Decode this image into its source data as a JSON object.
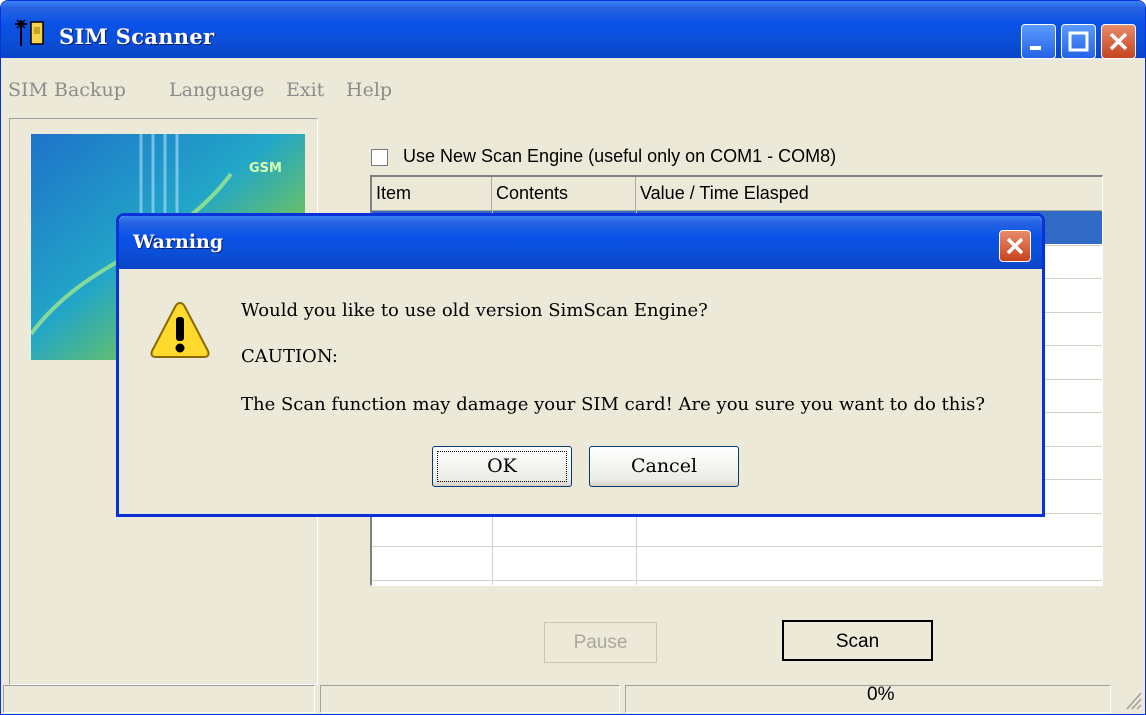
{
  "window": {
    "title": "SIM Scanner",
    "icons": {
      "app": "antenna-sim-icon",
      "minimize": "minimize-icon",
      "maximize": "maximize-icon",
      "close": "close-icon"
    }
  },
  "menu": {
    "items": [
      {
        "label": "SIM Backup",
        "hotkey": "B"
      },
      {
        "label": "Language",
        "hotkey": "L"
      },
      {
        "label": "Exit",
        "hotkey": "x"
      },
      {
        "label": "Help",
        "hotkey": "H"
      }
    ]
  },
  "main": {
    "logo_text": "GSM",
    "checkbox": {
      "label": "Use New Scan Engine (useful only on COM1 - COM8)",
      "checked": false
    },
    "table": {
      "columns": [
        "Item",
        "Contents",
        "Value / Time Elasped"
      ],
      "visible_row_count": 11
    },
    "buttons": {
      "pause": "Pause",
      "scan": "Scan"
    },
    "pause_enabled": false
  },
  "status": {
    "progress_text": "0%",
    "progress_value": 0
  },
  "dialog": {
    "title": "Warning",
    "icon": "warning-icon",
    "line1": "Would you like to use old version SimScan Engine?",
    "line2": "CAUTION:",
    "line3": "The Scan function may damage your SIM card! Are you sure you want to do this?",
    "ok_label": "OK",
    "cancel_label": "Cancel"
  },
  "colors": {
    "titlebar": "#0A52E8",
    "selection": "#316AC5",
    "face": "#ECE9D8",
    "close": "#C6431E"
  }
}
